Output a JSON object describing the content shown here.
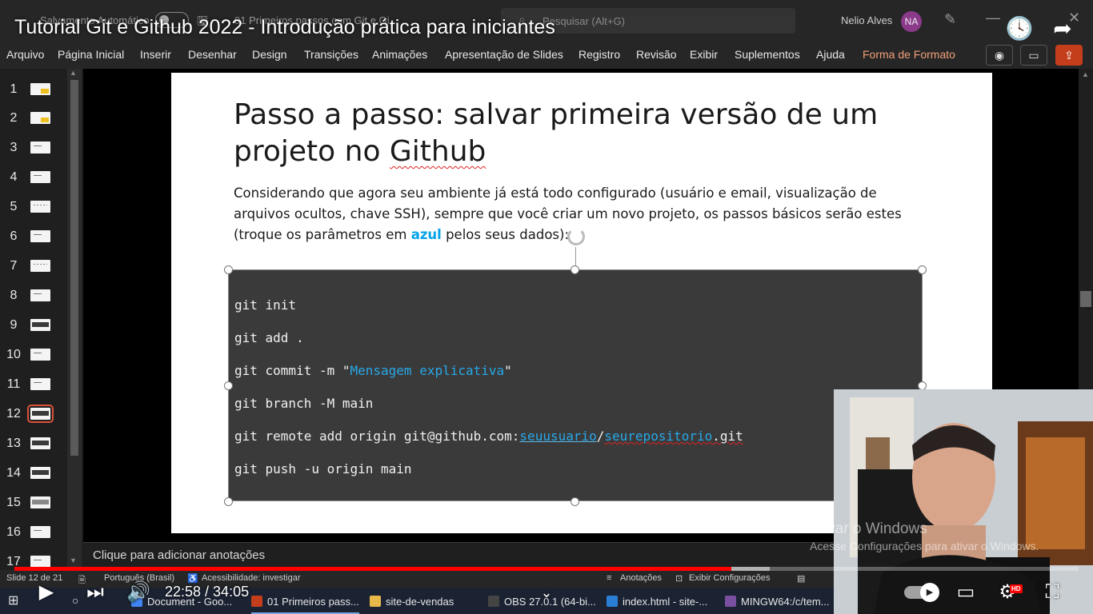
{
  "ppt": {
    "titlebar": {
      "autosave_label": "Salvamento Automático",
      "doc_name": "01 Primeiros passos com Git e Gi...",
      "search_placeholder": "Pesquisar (Alt+G)",
      "user_name": "Nelio Alves",
      "user_initials": "NA"
    },
    "ribbon_tabs": [
      "Arquivo",
      "Página Inicial",
      "Inserir",
      "Desenhar",
      "Design",
      "Transições",
      "Animações",
      "Apresentação de Slides",
      "Registro",
      "Revisão",
      "Exibir",
      "Suplementos",
      "Ajuda",
      "Forma de Formato"
    ],
    "thumbnails": [
      "1",
      "2",
      "3",
      "4",
      "5",
      "6",
      "7",
      "8",
      "9",
      "10",
      "11",
      "12",
      "13",
      "14",
      "15",
      "16",
      "17"
    ],
    "selected_slide": "12",
    "slide": {
      "title_part1": "Passo a passo: salvar primeira versão de um projeto no ",
      "title_part2": "Github",
      "body_part1": "Considerando que agora seu ambiente já está todo configurado (usuário e email, visualização de arquivos ocultos,  chave SSH), sempre que você criar um novo projeto, os passos básicos serão estes (troque os parâmetros em ",
      "body_blue": "azul",
      "body_part2": " pelos seus dados):",
      "code": {
        "l1": "git init",
        "l2": "git add .",
        "l3_pre": "git commit -m \"",
        "l3_param": "Mensagem explicativa",
        "l3_post": "\"",
        "l4": "git branch -M main",
        "l5_pre": "git remote add origin git@github.com:",
        "l5_user": "seuusuario",
        "l5_sep": "/",
        "l5_repo": "seurepositorio",
        "l5_post": ".git",
        "l6": "git push -u origin main"
      }
    },
    "notes_placeholder": "Clique para adicionar anotações",
    "statusbar": {
      "slide_of": "Slide 12 de 21",
      "language": "Português (Brasil)",
      "accessibility": "Acessibilidade: investigar",
      "notes": "Anotações",
      "display_settings": "Exibir Configurações"
    },
    "taskbar": [
      {
        "label": "Document - Goo...",
        "color": "#4285f4"
      },
      {
        "label": "01 Primeiros pass...",
        "color": "#c43e1c"
      },
      {
        "label": "site-de-vendas",
        "color": "#e8b84a"
      },
      {
        "label": "OBS 27.0.1 (64-bi...",
        "color": "#444444"
      },
      {
        "label": "index.html - site-...",
        "color": "#2a7fd4"
      },
      {
        "label": "MINGW64:/c/tem...",
        "color": "#7a4fa0"
      }
    ]
  },
  "watermark": {
    "line1": "Ativar o Windows",
    "line2": "Acesse Configurações para ativar o Windows."
  },
  "youtube": {
    "video_title": "Tutorial Git e Github 2022 - Introdução prática para iniciantes",
    "time": "22:58 / 34:05",
    "progress_fraction": 0.674,
    "buffered_fraction": 0.71,
    "hd_label": "HD"
  }
}
